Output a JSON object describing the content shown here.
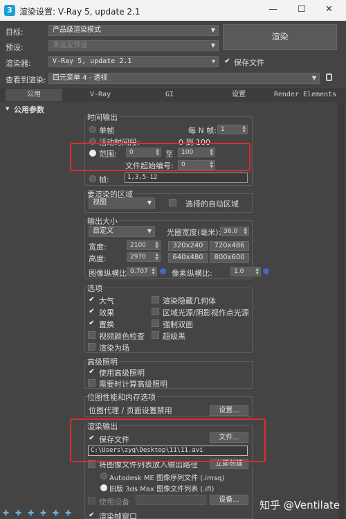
{
  "window": {
    "title": "渲染设置: V-Ray 5, update 2.1",
    "icon": "3",
    "min": "—",
    "max": "☐",
    "close": "✕"
  },
  "top": {
    "target_label": "目标:",
    "target_value": "产品级渲染模式",
    "preset_label": "预设:",
    "preset_value": "未选定预设",
    "renderer_label": "渲染器:",
    "renderer_value": "V-Ray 5, update 2.1",
    "save_file_label": "保存文件",
    "view_label": "查看到渲染:",
    "view_value": "四元菜单 4 - 透视",
    "render_button": "渲染"
  },
  "tabs": [
    "公用",
    "V-Ray",
    "GI",
    "设置",
    "Render Elements"
  ],
  "rollout_title": "公用参数",
  "time_output": {
    "title": "时间输出",
    "single": "单帧",
    "every_n": "每 N 帧:",
    "every_n_value": "1",
    "active": "活动时间段:",
    "active_range": "0 到 100",
    "range": "范围:",
    "range_from": "0",
    "to": "至",
    "range_to": "100",
    "file_start_label": "文件起始编号:",
    "file_start_value": "0",
    "frames": "帧:",
    "frames_value": "1,3,5-12"
  },
  "area": {
    "title": "要渲染的区域",
    "value": "视图",
    "auto_region": "选择的自动区域"
  },
  "output_size": {
    "title": "输出大小",
    "preset": "自定义",
    "aperture_label": "光圈宽度(毫米):",
    "aperture_value": "36.0",
    "width_label": "宽度:",
    "width_value": "2100",
    "height_label": "高度:",
    "height_value": "2970",
    "presets": [
      "320x240",
      "720x486",
      "640x480",
      "800x600"
    ],
    "image_aspect_label": "图像纵横比:",
    "image_aspect_value": "0.707",
    "pixel_aspect_label": "像素纵横比:",
    "pixel_aspect_value": "1.0"
  },
  "options": {
    "title": "选项",
    "items": [
      {
        "label": "大气",
        "checked": true
      },
      {
        "label": "渲染隐藏几何体",
        "checked": false
      },
      {
        "label": "效果",
        "checked": true
      },
      {
        "label": "区域光源/阴影视作点光源",
        "checked": false
      },
      {
        "label": "置换",
        "checked": true
      },
      {
        "label": "强制双面",
        "checked": false
      },
      {
        "label": "视频颜色检查",
        "checked": false
      },
      {
        "label": "超级黑",
        "checked": false
      },
      {
        "label": "渲染为场",
        "checked": false
      }
    ]
  },
  "advanced_lighting": {
    "title": "高级照明",
    "use": "使用高级照明",
    "compute": "需要时计算高级照明"
  },
  "bitmap": {
    "title": "位图性能和内存选项",
    "proxy": "位图代理 / 页面设置禁用",
    "setup": "设置..."
  },
  "render_output": {
    "title": "渲染输出",
    "save_file": "保存文件",
    "files_button": "文件...",
    "path": "C:\\Users\\zyq\\Desktop\\11\\11.avi",
    "put_in_output": "将图像文件列表放入输出路径",
    "create_now": "立即创建",
    "autodesk_seq": "Autodesk ME 图像序列文件 (.imsq)",
    "legacy_seq": "旧版 3ds Max 图像文件列表 (.ifl)",
    "use_device": "使用设备",
    "device_button": "设备...",
    "frame_window": "渲染帧窗口"
  },
  "watermark": "知乎 @Ventilate",
  "colors": {
    "bg": "#444444",
    "highlight": "#e02b2b",
    "accent": "#4863c9"
  }
}
